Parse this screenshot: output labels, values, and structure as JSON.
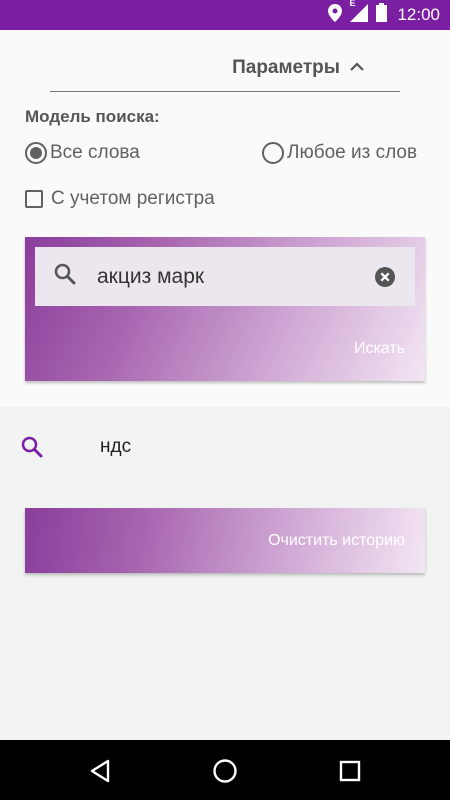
{
  "status_bar": {
    "time": "12:00",
    "network_label": "E",
    "color": "#7b1fa2"
  },
  "params": {
    "title": "Параметры"
  },
  "search_model": {
    "label": "Модель поиска:",
    "options": [
      {
        "label": "Все слова",
        "selected": true
      },
      {
        "label": "Любое из слов",
        "selected": false
      }
    ]
  },
  "case_sensitive": {
    "label": "С учетом регистра",
    "checked": false
  },
  "search": {
    "value": "акциз марк",
    "button_label": "Искать"
  },
  "history": {
    "items": [
      {
        "text": "ндс"
      }
    ],
    "clear_label": "Очистить историю"
  },
  "colors": {
    "accent": "#7b1fa2",
    "text_gray": "#616161"
  },
  "icons": [
    "location-icon",
    "signal-icon",
    "battery-icon",
    "chevron-up-icon",
    "search-icon",
    "clear-icon",
    "back-icon",
    "home-icon",
    "recents-icon"
  ]
}
